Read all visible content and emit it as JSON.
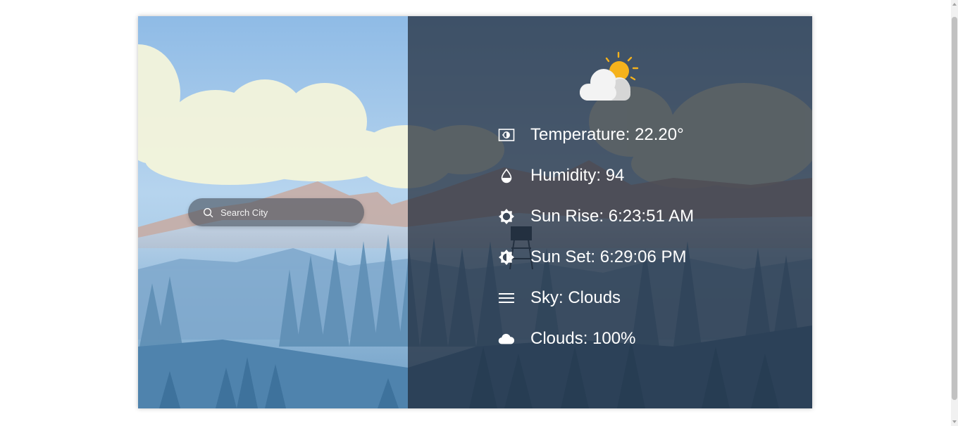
{
  "search": {
    "placeholder": "Search City",
    "icon": "search-icon"
  },
  "weather": {
    "condition_icon": "partly-cloudy-icon",
    "rows": [
      {
        "icon": "thermometer-icon",
        "label": "Temperature: 22.20°"
      },
      {
        "icon": "water-drop-icon",
        "label": "Humidity: 94"
      },
      {
        "icon": "sunrise-icon",
        "label": "Sun Rise: 6:23:51 AM"
      },
      {
        "icon": "sunset-icon",
        "label": "Sun Set: 6:29:06 PM"
      },
      {
        "icon": "menu-lines-icon",
        "label": "Sky: Clouds"
      },
      {
        "icon": "cloud-icon",
        "label": "Clouds: 100%"
      }
    ]
  },
  "colors": {
    "sun": "#f5b21c",
    "overlay": "#1e2838",
    "text": "#ffffff"
  }
}
